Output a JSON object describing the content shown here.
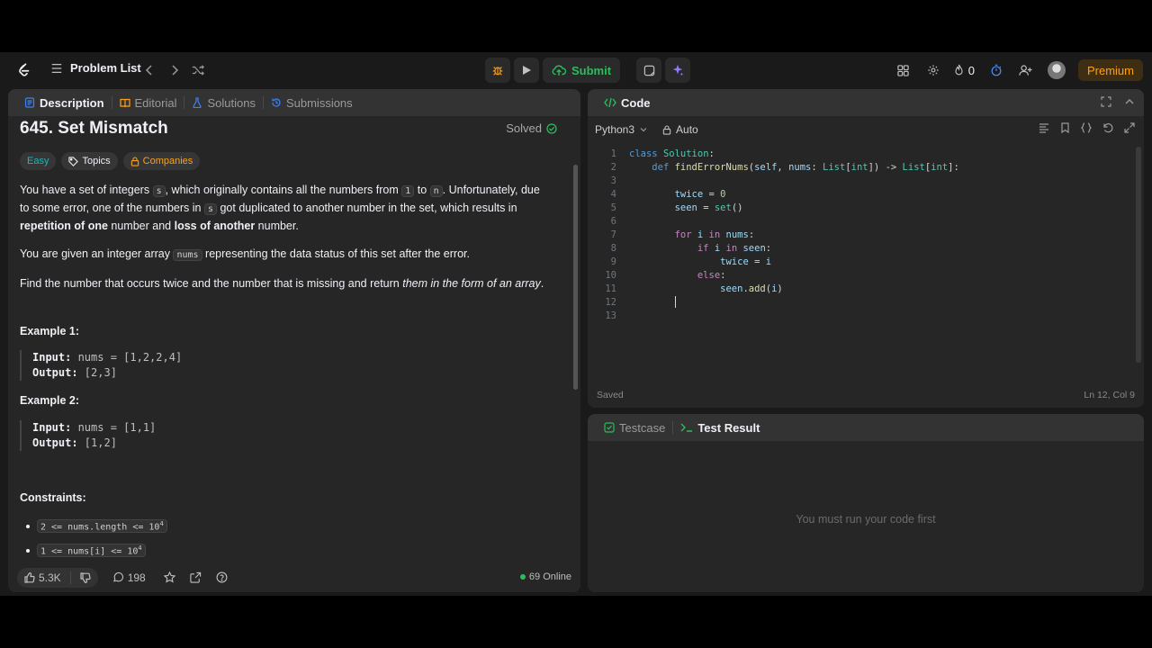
{
  "topbar": {
    "problem_list_label": "Problem List",
    "submit_label": "Submit",
    "streak_count": "0",
    "premium_label": "Premium"
  },
  "left_tabs": [
    {
      "label": "Description",
      "icon": "description-icon",
      "color": "#3b82f6"
    },
    {
      "label": "Editorial",
      "icon": "editorial-icon",
      "color": "#ffa116"
    },
    {
      "label": "Solutions",
      "icon": "solutions-icon",
      "color": "#3b82f6"
    },
    {
      "label": "Submissions",
      "icon": "submissions-icon",
      "color": "#3b82f6"
    }
  ],
  "problem": {
    "title": "645. Set Mismatch",
    "status": "Solved",
    "difficulty": "Easy",
    "topics_label": "Topics",
    "companies_label": "Companies",
    "para1_a": "You have a set of integers ",
    "para1_s": "s",
    "para1_b": ", which originally contains all the numbers from ",
    "para1_1": "1",
    "para1_c": " to ",
    "para1_n": "n",
    "para1_d": ". Unfortunately, due to some error, one of the numbers in ",
    "para1_s2": "s",
    "para1_e": " got duplicated to another number in the set, which results in ",
    "para1_bold1": "repetition of one",
    "para1_f": " number and ",
    "para1_bold2": "loss of another",
    "para1_g": " number.",
    "para2_a": "You are given an integer array ",
    "para2_code": "nums",
    "para2_b": " representing the data status of this set after the error.",
    "para3_a": "Find the number that occurs twice and the number that is missing and return ",
    "para3_em": "them in the form of an array",
    "para3_b": ".",
    "example1_title": "Example 1:",
    "example1_input_label": "Input:",
    "example1_input": " nums = [1,2,2,4]",
    "example1_output_label": "Output:",
    "example1_output": " [2,3]",
    "example2_title": "Example 2:",
    "example2_input_label": "Input:",
    "example2_input": " nums = [1,1]",
    "example2_output_label": "Output:",
    "example2_output": " [1,2]",
    "constraints_title": "Constraints:",
    "constraint1": "2 <= nums.length <= 10",
    "constraint1_sup": "4",
    "constraint2": "1 <= nums[i] <= 10",
    "constraint2_sup": "4"
  },
  "left_footer": {
    "likes": "5.3K",
    "comments": "198",
    "online": "69 Online"
  },
  "editor": {
    "tab_label": "Code",
    "language": "Python3",
    "mode": "Auto",
    "status": "Saved",
    "cursor": "Ln 12, Col 9",
    "line_numbers": [
      "1",
      "2",
      "3",
      "4",
      "5",
      "6",
      "7",
      "8",
      "9",
      "10",
      "11",
      "12",
      "13"
    ]
  },
  "results": {
    "testcase_label": "Testcase",
    "test_result_label": "Test Result",
    "message": "You must run your code first"
  }
}
